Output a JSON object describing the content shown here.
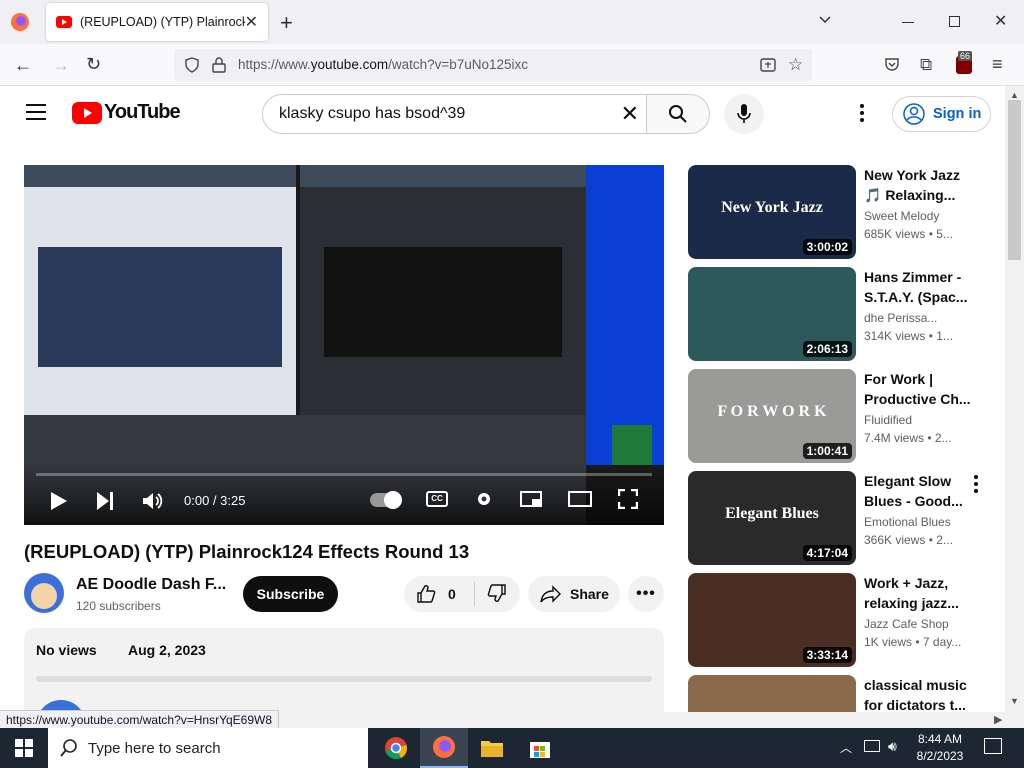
{
  "browser": {
    "tab_title": "(REUPLOAD) (YTP) Plainrock124 Effects Round 13",
    "url_prefix": "https://www.",
    "url_domain": "youtube.com",
    "url_rest": "/watch?v=b7uNo125ixc",
    "extension_badge": "66",
    "status_url": "https://www.youtube.com/watch?v=HnsrYqE69W8"
  },
  "header": {
    "logo_text": "YouTube",
    "search_value": "klasky csupo has bsod^39",
    "sign_in": "Sign in"
  },
  "player": {
    "time": "0:00 / 3:25",
    "progress": 0
  },
  "video": {
    "title": "(REUPLOAD) (YTP) Plainrock124 Effects Round 13",
    "channel": "AE Doodle Dash F...",
    "subscribers": "120 subscribers",
    "subscribe": "Subscribe",
    "likes": "0",
    "share": "Share",
    "views": "No views",
    "date": "Aug 2, 2023"
  },
  "recommendations": [
    {
      "title": "New York Jazz 🎵 Relaxing...",
      "channel": "Sweet Melody",
      "meta": "685K views • 5...",
      "duration": "3:00:02",
      "thumb_text": "New York Jazz",
      "color": "#1c2a4a"
    },
    {
      "title": "Hans Zimmer - S.T.A.Y. (Spac...",
      "channel": "dhe Perissa...",
      "meta": "314K views • 1...",
      "duration": "2:06:13",
      "thumb_text": "",
      "color": "#2c5a5c"
    },
    {
      "title": "For Work | Productive Ch...",
      "channel": "Fluidified",
      "meta": "7.4M views • 2...",
      "duration": "1:00:41",
      "thumb_text": "F O R  W O R K",
      "color": "#9a9a98"
    },
    {
      "title": "Elegant Slow Blues - Good...",
      "channel": "Emotional Blues",
      "meta": "366K views • 2...",
      "duration": "4:17:04",
      "thumb_text": "Elegant Blues",
      "color": "#2a2a2a"
    },
    {
      "title": "Work + Jazz, relaxing jazz...",
      "channel": "Jazz Cafe Shop",
      "meta": "1K views • 7 day...",
      "duration": "3:33:14",
      "thumb_text": "",
      "color": "#4a2e22"
    },
    {
      "title": "classical music for dictators t...",
      "channel": "",
      "meta": "",
      "duration": "",
      "thumb_text": "",
      "color": "#8a6a4a"
    }
  ],
  "taskbar": {
    "search_placeholder": "Type here to search",
    "time": "8:44 AM",
    "date": "8/2/2023"
  }
}
